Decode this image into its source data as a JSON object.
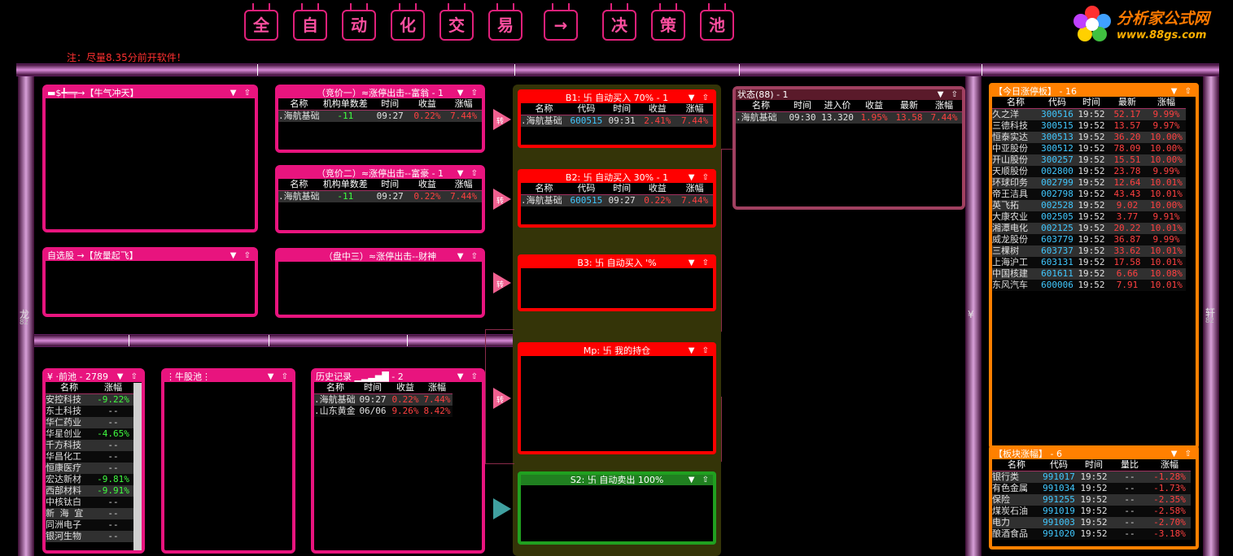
{
  "top_buttons": [
    "全",
    "自",
    "动",
    "化",
    "交",
    "易",
    "→",
    "决",
    "策",
    "池"
  ],
  "note": "注：尽量8.35分前开软件！",
  "logo": {
    "line1": "分析家公式网",
    "line2": "www.88gs.com"
  },
  "side_left": {
    "char": "龙",
    "num": "82"
  },
  "side_right": {
    "char": "轩",
    "num": "82"
  },
  "side_mid": {
    "char": "¥"
  },
  "win_ctl": "▼ ⇧",
  "w_niuqi": {
    "title": "▬$╇═╤→【牛气冲天】"
  },
  "w_zixuan": {
    "title": "自选股 →【放量起飞】"
  },
  "w_jing1": {
    "title": "（竞价一）≈涨停出击--富翁 - 1",
    "headers": [
      "名称",
      "机构单数差",
      "时间",
      "收益",
      "涨幅"
    ],
    "rows": [
      [
        ".海航基础",
        "-11",
        "09:27",
        "0.22%",
        "7.44%"
      ]
    ]
  },
  "w_jing2": {
    "title": "（竞价二）≈涨停出击--富豪 - 1",
    "headers": [
      "名称",
      "机构单数差",
      "时间",
      "收益",
      "涨幅"
    ],
    "rows": [
      [
        ".海航基础",
        "-11",
        "09:27",
        "0.22%",
        "7.44%"
      ]
    ]
  },
  "w_pan3": {
    "title": "（盘中三）≈涨停出击--财神"
  },
  "arrow_label": "转",
  "b1": {
    "title": "B1: 卐 自动买入 70% - 1",
    "headers": [
      "名称",
      "代码",
      "时间",
      "收益",
      "涨幅"
    ],
    "rows": [
      [
        ".海航基础",
        "600515",
        "09:31",
        "2.41%",
        "7.44%"
      ]
    ]
  },
  "b2": {
    "title": "B2: 卐 自动买入 30% - 1",
    "headers": [
      "名称",
      "代码",
      "时间",
      "收益",
      "涨幅"
    ],
    "rows": [
      [
        ".海航基础",
        "600515",
        "09:27",
        "0.22%",
        "7.44%"
      ]
    ]
  },
  "b3": {
    "title": "B3: 卐 自动买入 '%"
  },
  "mp": {
    "title": "Mp: 卐 我的持仓"
  },
  "s2": {
    "title": "S2: 卐 自动卖出 100%"
  },
  "status": {
    "title": "状态(88) - 1",
    "headers": [
      "名称",
      "时间",
      "进入价",
      "收益",
      "最新",
      "涨幅"
    ],
    "rows": [
      [
        ".海航基础",
        "09:30",
        "13.320",
        "1.95%",
        "13.58",
        "7.44%"
      ]
    ]
  },
  "qianchi": {
    "title": "¥ ·前池 - 2789",
    "headers": [
      "名称",
      "涨幅"
    ],
    "rows": [
      [
        "安控科技",
        "-9.22%"
      ],
      [
        "东土科技",
        "--"
      ],
      [
        "华仁药业",
        "--"
      ],
      [
        "华星创业",
        "-4.65%"
      ],
      [
        "千方科技",
        "--"
      ],
      [
        "华昌化工",
        "--"
      ],
      [
        "恒康医疗",
        "--"
      ],
      [
        "宏达新材",
        "-9.81%"
      ],
      [
        "西部材料",
        "-9.91%"
      ],
      [
        "中核钛白",
        "--"
      ],
      [
        "新 海 宜",
        "--"
      ],
      [
        "同洲电子",
        "--"
      ],
      [
        "银河生物",
        "--"
      ]
    ]
  },
  "niugu": {
    "title": "⋮牛股池⋮"
  },
  "history": {
    "title": "历史记录 ▁▂▃▅█ - 2",
    "headers": [
      "名称",
      "时间",
      "收益",
      "涨幅"
    ],
    "rows": [
      [
        ".海航基础",
        "09:27",
        "0.22%",
        "7.44%"
      ],
      [
        ".山东黄金",
        "06/06",
        "9.26%",
        "8.42%"
      ]
    ]
  },
  "zhangting": {
    "title": "【今日涨停板】 - 16",
    "headers": [
      "名称",
      "代码",
      "时间",
      "最新",
      "涨幅"
    ],
    "rows": [
      [
        "久之洋",
        "300516",
        "19:52",
        "52.17",
        "9.99%"
      ],
      [
        "三德科技",
        "300515",
        "19:52",
        "13.57",
        "9.97%"
      ],
      [
        "恒泰实达",
        "300513",
        "19:52",
        "36.20",
        "10.00%"
      ],
      [
        "中亚股份",
        "300512",
        "19:52",
        "78.09",
        "10.00%"
      ],
      [
        "开山股份",
        "300257",
        "19:52",
        "15.51",
        "10.00%"
      ],
      [
        "天顺股份",
        "002800",
        "19:52",
        "23.78",
        "9.99%"
      ],
      [
        "环球印务",
        "002799",
        "19:52",
        "12.64",
        "10.01%"
      ],
      [
        "帝王洁具",
        "002798",
        "19:52",
        "43.43",
        "10.01%"
      ],
      [
        "英飞拓",
        "002528",
        "19:52",
        "9.02",
        "10.00%"
      ],
      [
        "大康农业",
        "002505",
        "19:52",
        "3.77",
        "9.91%"
      ],
      [
        "湘潭电化",
        "002125",
        "19:52",
        "20.22",
        "10.01%"
      ],
      [
        "威龙股份",
        "603779",
        "19:52",
        "36.87",
        "9.99%"
      ],
      [
        "三棵树",
        "603737",
        "19:52",
        "33.62",
        "10.01%"
      ],
      [
        "上海沪工",
        "603131",
        "19:52",
        "17.58",
        "10.01%"
      ],
      [
        "中国核建",
        "601611",
        "19:52",
        "6.66",
        "10.08%"
      ],
      [
        "东风汽车",
        "600006",
        "19:52",
        "7.91",
        "10.01%"
      ]
    ]
  },
  "bankuai": {
    "title": "【板块涨幅】 - 6",
    "headers": [
      "名称",
      "代码",
      "时间",
      "量比",
      "涨幅"
    ],
    "rows": [
      [
        "银行类",
        "991017",
        "19:52",
        "--",
        "-1.28%"
      ],
      [
        "有色金属",
        "991034",
        "19:52",
        "--",
        "-1.73%"
      ],
      [
        "保险",
        "991255",
        "19:52",
        "--",
        "-2.35%"
      ],
      [
        "煤炭石油",
        "991019",
        "19:52",
        "--",
        "-2.58%"
      ],
      [
        "电力",
        "991003",
        "19:52",
        "--",
        "-2.70%"
      ],
      [
        "酿酒食品",
        "991020",
        "19:52",
        "--",
        "-3.18%"
      ]
    ]
  }
}
